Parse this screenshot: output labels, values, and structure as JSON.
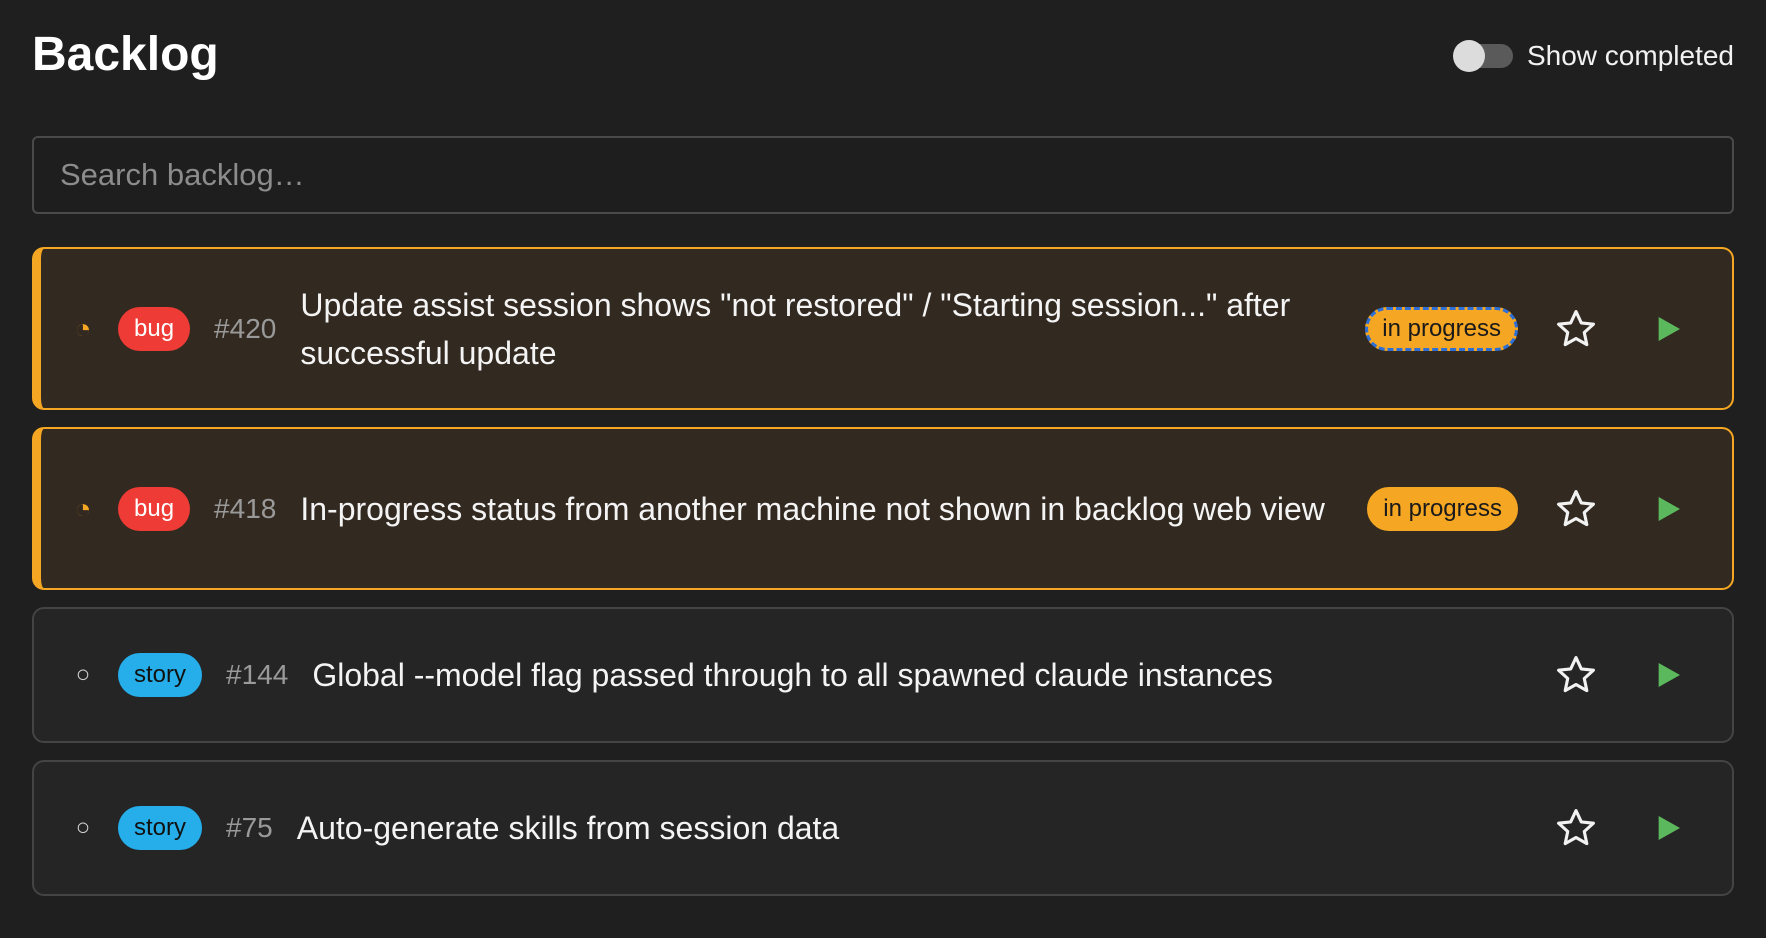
{
  "header": {
    "title": "Backlog",
    "toggle_label": "Show completed",
    "toggle_on": false
  },
  "search": {
    "placeholder": "Search backlog…",
    "value": ""
  },
  "items": [
    {
      "status_icon": "◔",
      "tag": "bug",
      "id": "#420",
      "title": "Update assist session shows \"not restored\" / \"Starting session...\" after successful update",
      "status": "in progress"
    },
    {
      "status_icon": "◔",
      "tag": "bug",
      "id": "#418",
      "title": "In-progress status from another machine not shown in backlog web view",
      "status": "in progress"
    },
    {
      "status_icon": "○",
      "tag": "story",
      "id": "#144",
      "title": "Global --model flag passed through to all spawned claude instances",
      "status": ""
    },
    {
      "status_icon": "○",
      "tag": "story",
      "id": "#75",
      "title": "Auto-generate skills from session data",
      "status": ""
    }
  ],
  "colors": {
    "background": "#1f1f1f",
    "in_progress": "#f5a623",
    "bug": "#ee3b36",
    "story": "#25aeea",
    "play": "#5cb85c",
    "focus_ring": "#2e6fd6"
  },
  "icons": {
    "status_in_progress": "partial-circle-icon",
    "status_open": "empty-circle-icon",
    "favorite": "star-outline-icon",
    "run": "play-icon"
  }
}
